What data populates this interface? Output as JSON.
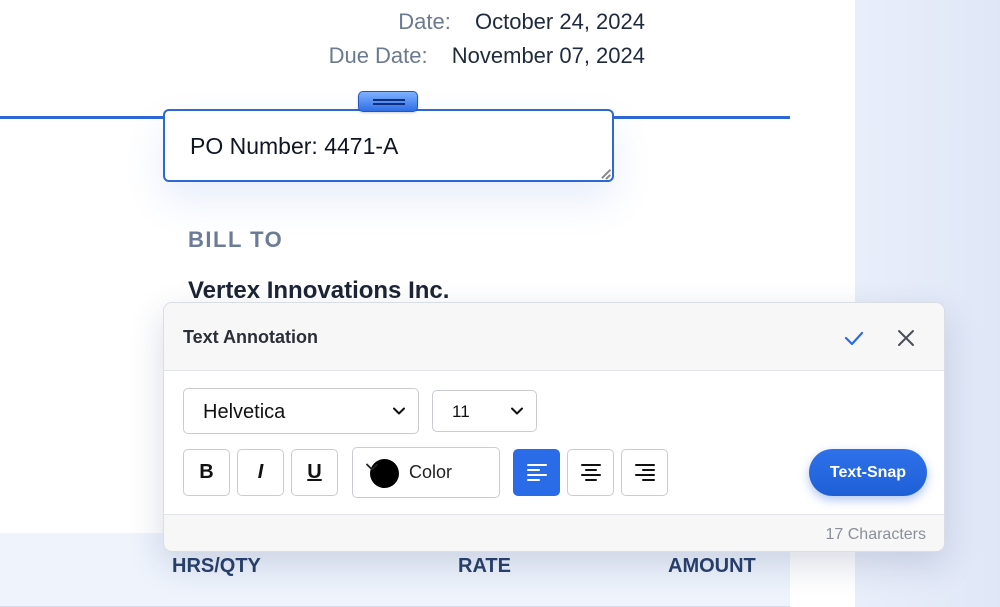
{
  "invoice": {
    "date_label": "Date:",
    "date_value": "October 24, 2024",
    "due_label": "Due Date:",
    "due_value": "November 07, 2024",
    "bill_to_label": "BILL TO",
    "client_name": "Vertex Innovations Inc."
  },
  "annotation_box": {
    "text": "PO Number: 4471-A"
  },
  "table": {
    "headers": [
      "HRS/QTY",
      "RATE",
      "AMOUNT"
    ]
  },
  "panel": {
    "title": "Text Annotation",
    "font_family": "Helvetica",
    "font_size": "11",
    "bold_label": "B",
    "italic_label": "I",
    "underline_label": "U",
    "color_label": "Color",
    "selected_color": "#000000",
    "alignment_selected": "left",
    "snap_label": "Text-Snap",
    "char_count": "17 Characters"
  },
  "colors": {
    "accent": "#2a6ce8",
    "border_active": "#2f67d6"
  }
}
